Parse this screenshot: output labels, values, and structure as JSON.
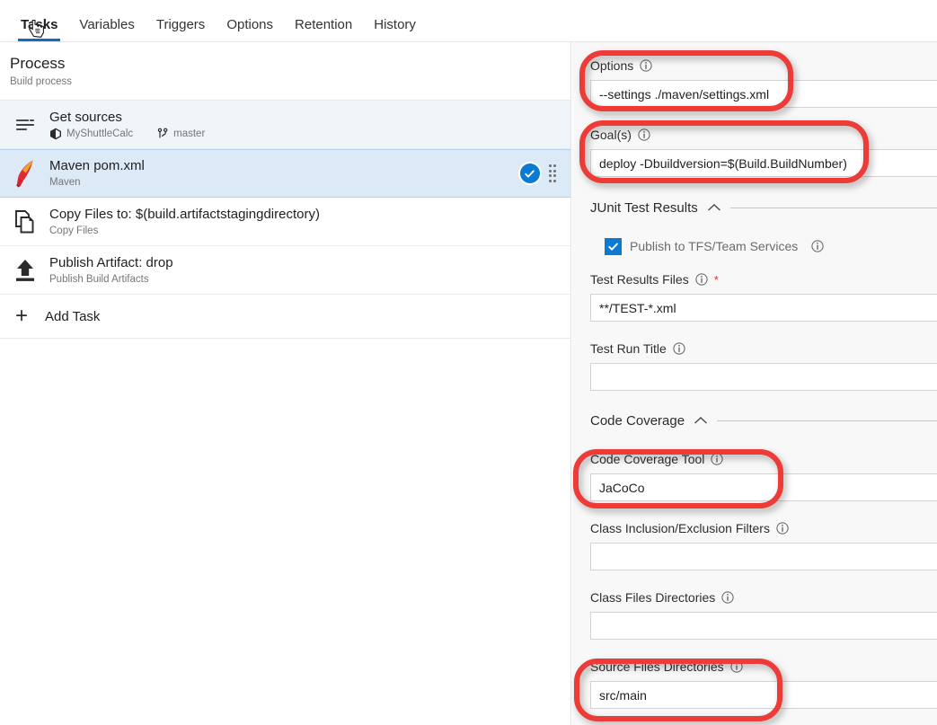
{
  "tabs": [
    {
      "label": "Tasks",
      "active": true
    },
    {
      "label": "Variables",
      "active": false
    },
    {
      "label": "Triggers",
      "active": false
    },
    {
      "label": "Options",
      "active": false
    },
    {
      "label": "Retention",
      "active": false
    },
    {
      "label": "History",
      "active": false
    }
  ],
  "process": {
    "title": "Process",
    "subtitle": "Build process"
  },
  "tasks": [
    {
      "name": "Get sources",
      "repo": "MyShuttleCalc",
      "branch": "master",
      "icon": "get-sources-icon",
      "state": "phase"
    },
    {
      "name": "Maven pom.xml",
      "subtitle": "Maven",
      "icon": "maven-feather-icon",
      "state": "selected",
      "status_icon": "check-circle-icon"
    },
    {
      "name": "Copy Files to: $(build.artifactstagingdirectory)",
      "subtitle": "Copy Files",
      "icon": "copy-files-icon",
      "state": "normal"
    },
    {
      "name": "Publish Artifact: drop",
      "subtitle": "Publish Build Artifacts",
      "icon": "publish-upload-icon",
      "state": "normal"
    }
  ],
  "add_task": {
    "label": "Add Task",
    "icon": "plus-icon"
  },
  "details": {
    "options_field": {
      "label": "Options",
      "value": "--settings ./maven/settings.xml",
      "info_icon": "info-icon",
      "highlighted": true
    },
    "goals_field": {
      "label": "Goal(s)",
      "value": "deploy -Dbuildversion=$(Build.BuildNumber)",
      "info_icon": "info-icon",
      "highlighted": true
    },
    "junit_section": {
      "title": "JUnit Test Results",
      "collapse_icon": "chevron-up-icon",
      "publish_checkbox": {
        "label": "Publish to TFS/Team Services",
        "checked": true,
        "info_icon": "info-icon"
      },
      "test_results_files": {
        "label": "Test Results Files",
        "value": "**/TEST-*.xml",
        "required": true,
        "required_marker": "*",
        "info_icon": "info-icon"
      },
      "test_run_title": {
        "label": "Test Run Title",
        "value": "",
        "info_icon": "info-icon"
      }
    },
    "coverage_section": {
      "title": "Code Coverage",
      "collapse_icon": "chevron-up-icon",
      "code_coverage_tool": {
        "label": "Code Coverage Tool",
        "value": "JaCoCo",
        "info_icon": "info-icon",
        "highlighted": true
      },
      "class_filters": {
        "label": "Class Inclusion/Exclusion Filters",
        "value": "",
        "info_icon": "info-icon"
      },
      "class_files_dirs": {
        "label": "Class Files Directories",
        "value": "",
        "info_icon": "info-icon"
      },
      "source_files_dirs": {
        "label": "Source Files Directories",
        "value": "src/main",
        "info_icon": "info-icon",
        "highlighted": true
      }
    }
  },
  "colors": {
    "accent_blue": "#0a7ad3",
    "tab_underline": "#106ebe",
    "annotation_red": "#ed3b37",
    "selected_row": "#dce9f7",
    "phase_row": "#f0f5fa",
    "panel_bg": "#f8f8f8",
    "required_star": "#d13438"
  }
}
